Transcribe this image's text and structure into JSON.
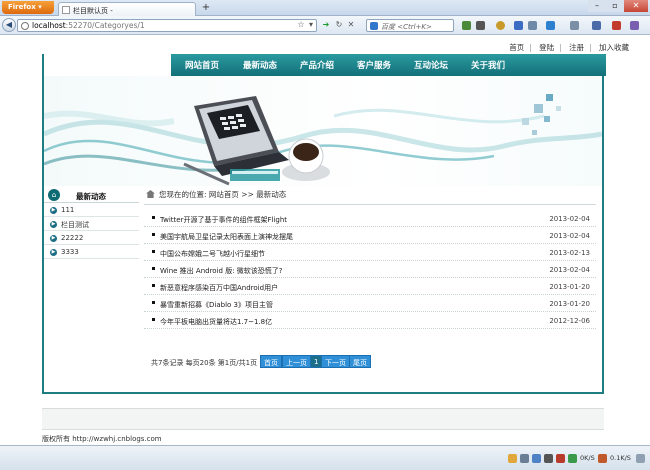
{
  "browser": {
    "app_button": "Firefox",
    "tab_title": "栏目默认页 -",
    "new_tab": "+",
    "url_host": "localhost",
    "url_path": ":52270/Categoryes/1",
    "search_placeholder": "百度 <Ctrl+K>",
    "status_down": "0K/S",
    "status_up": "0.1K/S"
  },
  "page": {
    "top_links": [
      "首页",
      "登陆",
      "注册",
      "加入收藏"
    ],
    "main_nav": [
      "网站首页",
      "最新动态",
      "产品介绍",
      "客户服务",
      "互动论坛",
      "关于我们"
    ],
    "sidebar": {
      "title": "最新动态",
      "items": [
        "111",
        "栏目测试",
        "22222",
        "3333"
      ]
    },
    "breadcrumb": "您现在的位置: 网站首页 >> 最新动态",
    "news": [
      {
        "title": "Twitter开源了基于事件的组件框架Flight",
        "date": "2013-02-04"
      },
      {
        "title": "美国宇航局卫星记录太阳表面上演神龙摆尾",
        "date": "2013-02-04"
      },
      {
        "title": "中国公布嫦娥二号飞越小行星细节",
        "date": "2013-02-13"
      },
      {
        "title": "Wine 推出 Android 版: 微软该恐慌了?",
        "date": "2013-02-04"
      },
      {
        "title": "新恶意程序感染百万中国Android用户",
        "date": "2013-01-20"
      },
      {
        "title": "暴雪重新招募《Diablo 3》项目主管",
        "date": "2013-01-20"
      },
      {
        "title": "今年平板电脑出货量将达1.7~1.8亿",
        "date": "2012-12-06"
      }
    ],
    "pager": {
      "info": "共7条记录  每页20条  第1页/共1页",
      "first": "首页",
      "prev": "上一页",
      "current": "1",
      "next": "下一页",
      "last": "尾页"
    },
    "copyright": "版权所有 http://wzwhj.cnblogs.com"
  }
}
